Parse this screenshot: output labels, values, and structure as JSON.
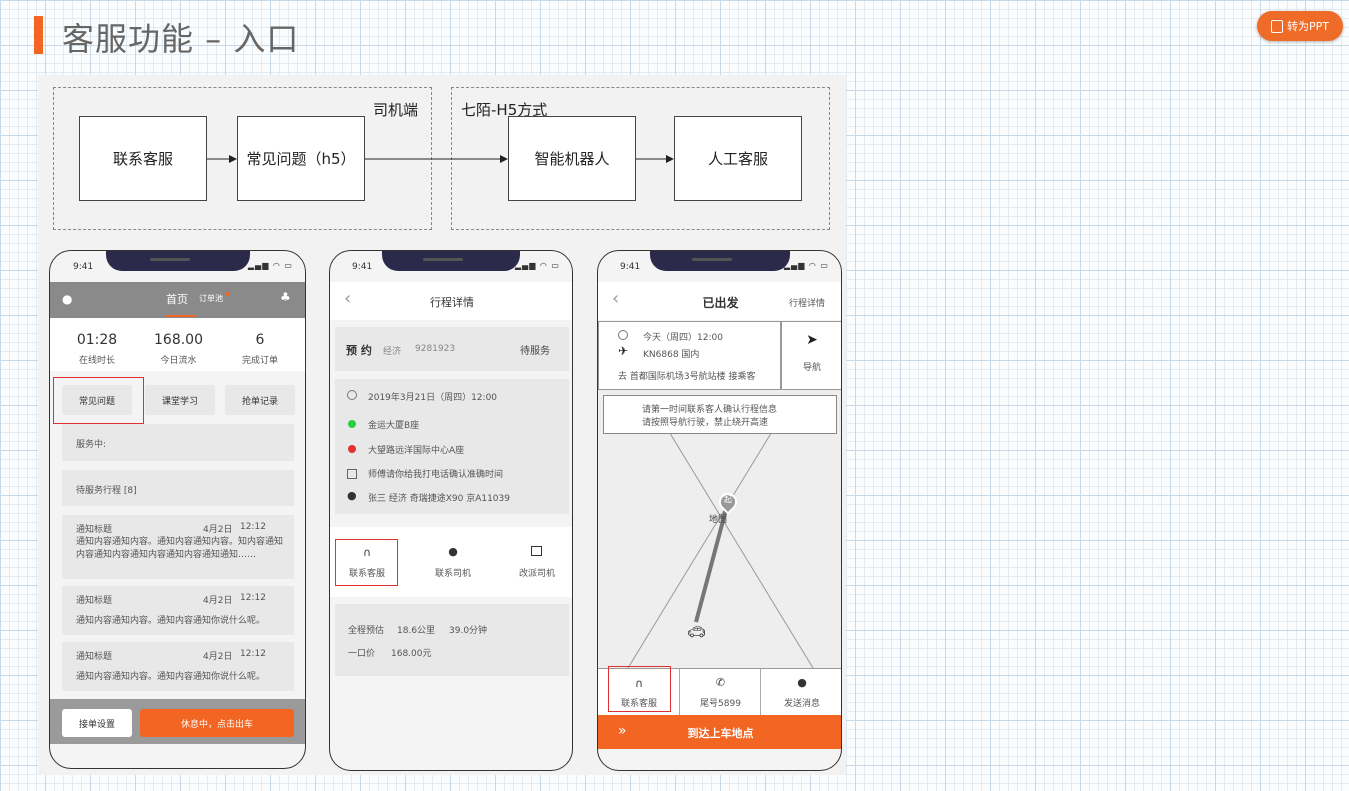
{
  "header": {
    "title": "客服功能 – 入口",
    "ppt_label": "转为PPT"
  },
  "flow": {
    "driver_group": "司机端",
    "h5_group": "七陌-H5方式",
    "boxes": [
      "联系客服",
      "常见问题（h5）",
      "智能机器人",
      "人工客服"
    ]
  },
  "phone1": {
    "time": "9:41",
    "tab_home": "首页",
    "tab_grab": "订单池",
    "stats": [
      {
        "value": "01:28",
        "label": "在线时长"
      },
      {
        "value": "168.00",
        "label": "今日流水"
      },
      {
        "value": "6",
        "label": "完成订单"
      }
    ],
    "quick": [
      "常见问题",
      "课堂学习",
      "抢单记录"
    ],
    "in_service": "服务中:",
    "pending": "待服务行程 [8]",
    "notices": [
      {
        "title": "通知标题",
        "date": "4月2日",
        "time": "12:12",
        "body": "通知内容通知内容。通知内容通知内容。知内容通知内容通知内容通知内容通知内容通知通知……"
      },
      {
        "title": "通知标题",
        "date": "4月2日",
        "time": "12:12",
        "body": "通知内容通知内容。通知内容通知你说什么呢。"
      },
      {
        "title": "通知标题",
        "date": "4月2日",
        "time": "12:12",
        "body": "通知内容通知内容。通知内容通知你说什么呢。"
      }
    ],
    "settings_btn": "接单设置",
    "rest_btn": "休息中，点击出车"
  },
  "phone2": {
    "time": "9:41",
    "nav_title": "行程详情",
    "booking": "预 约",
    "booking_type": "经济",
    "order_no": "9281923",
    "status": "待服务",
    "datetime": "2019年3月21日（周四）12:00",
    "start": "金运大厦B座",
    "end": "大望路远洋国际中心A座",
    "note": "师傅请你给我打电话确认准确时间",
    "passenger": "张三 经济 奇瑞捷途X90 京A11039",
    "actions": [
      "联系客服",
      "联系司机",
      "改派司机"
    ],
    "estimate_label": "全程预估",
    "distance": "18.6公里",
    "duration": "39.0分钟",
    "price_label": "一口价",
    "price": "168.00元"
  },
  "phone3": {
    "time": "9:41",
    "nav_title": "已出发",
    "nav_right": "行程详情",
    "when": "今天（周四）12:00",
    "flight": "KN6868 国内",
    "dest": "去 首都国际机场3号航站楼 接乘客",
    "nav_btn": "导航",
    "tip1": "请第一时间联系客人确认行程信息",
    "tip2": "请按照导航行驶，禁止绕开高速",
    "pin": "起",
    "map_label": "地图",
    "actions": [
      "联系客服",
      "尾号5899",
      "发送消息"
    ],
    "arrive": "到达上车地点"
  }
}
